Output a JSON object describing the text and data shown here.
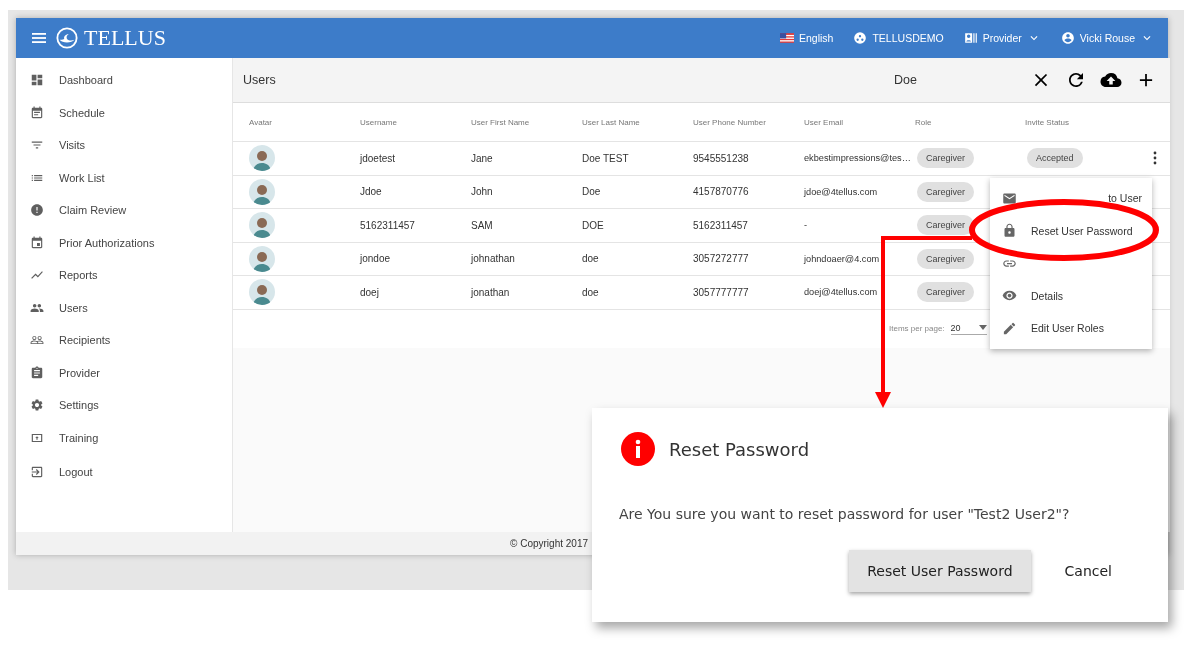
{
  "app": {
    "logo_text": "TELLUS"
  },
  "top_bar": {
    "language": "English",
    "organization": "TELLUSDEMO",
    "role_menu": "Provider",
    "user_menu": "Vicki Rouse"
  },
  "sidebar": {
    "items": [
      {
        "label": "Dashboard",
        "kind": "dashboard"
      },
      {
        "label": "Schedule",
        "kind": "schedule"
      },
      {
        "label": "Visits",
        "kind": "visits"
      },
      {
        "label": "Work List",
        "kind": "worklist"
      },
      {
        "label": "Claim Review",
        "kind": "claim"
      },
      {
        "label": "Prior Authorizations",
        "kind": "auth"
      },
      {
        "label": "Reports",
        "kind": "reports"
      },
      {
        "label": "Users",
        "kind": "users"
      },
      {
        "label": "Recipients",
        "kind": "recipients"
      },
      {
        "label": "Provider",
        "kind": "provider"
      },
      {
        "label": "Settings",
        "kind": "settings"
      },
      {
        "label": "Training",
        "kind": "training"
      },
      {
        "label": "Logout",
        "kind": "logout"
      }
    ]
  },
  "page": {
    "title": "Users",
    "search_value": "Doe"
  },
  "table": {
    "columns": [
      "Avatar",
      "Username",
      "User First Name",
      "User Last Name",
      "User Phone Number",
      "User Email",
      "Role",
      "Invite Status"
    ],
    "rows": [
      {
        "username": "jdoetest",
        "first_name": "Jane",
        "last_name": "Doe TEST",
        "phone": "9545551238",
        "email": "ekbestimpressions@tes…",
        "role": "Caregiver",
        "invite_status": "Accepted",
        "show_actions": true
      },
      {
        "username": "Jdoe",
        "first_name": "John",
        "last_name": "Doe",
        "phone": "4157870776",
        "email": "jdoe@4tellus.com",
        "role": "Caregiver",
        "show_actions": false
      },
      {
        "username": "5162311457",
        "first_name": "SAM",
        "last_name": "DOE",
        "phone": "5162311457",
        "email": "-",
        "role": "Caregiver",
        "show_actions": false
      },
      {
        "username": "jondoe",
        "first_name": "johnathan",
        "last_name": "doe",
        "phone": "3057272777",
        "email": "johndoaer@4.com",
        "role": "Caregiver",
        "show_actions": false
      },
      {
        "username": "doej",
        "first_name": "jonathan",
        "last_name": "doe",
        "phone": "3057777777",
        "email": "doej@4tellus.com",
        "role": "Caregiver",
        "show_actions": false
      }
    ]
  },
  "paginator": {
    "label": "Items per page:",
    "value": "20"
  },
  "footer": {
    "copyright": "© Copyright 2017"
  },
  "context_menu": {
    "items": [
      {
        "label": "to User",
        "kind": "mail"
      },
      {
        "label": "Reset User Password",
        "kind": "lock"
      },
      {
        "kind": "link"
      },
      {
        "label": "Details",
        "kind": "eye"
      },
      {
        "label": "Edit User Roles",
        "kind": "edit"
      }
    ]
  },
  "dialog": {
    "title": "Reset Password",
    "message": "Are You sure you want to reset password for user \"Test2 User2\"?",
    "buttons": [
      {
        "label": "Reset User Password",
        "kind": "raised"
      },
      {
        "label": "Cancel",
        "kind": "flat"
      }
    ]
  }
}
